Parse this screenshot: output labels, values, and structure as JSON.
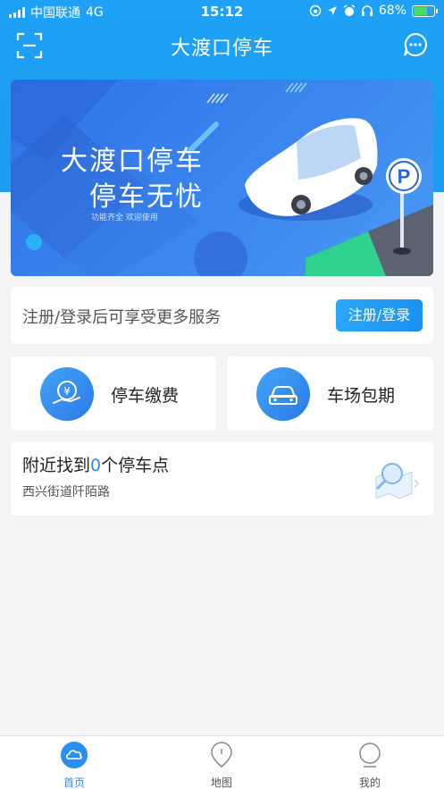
{
  "status_bar": {
    "carrier": "中国联通",
    "network": "4G",
    "time": "15:12",
    "battery": "68%",
    "battery_level": 0.68
  },
  "nav": {
    "title": "大渡口停车"
  },
  "banner": {
    "line1": "大渡口停车",
    "line2": "停车无忧",
    "caption": "功能齐全 欢迎使用"
  },
  "login": {
    "prompt": "注册/登录后可享受更多服务",
    "button_label": "注册/登录"
  },
  "functions": [
    {
      "label": "停车缴费",
      "icon": "yen-hand-icon"
    },
    {
      "label": "车场包期",
      "icon": "car-icon"
    }
  ],
  "nearby": {
    "prefix": "附近找到",
    "count": "0",
    "suffix": "个停车点",
    "address": "西兴街道阡陌路"
  },
  "tabbar": {
    "items": [
      {
        "label": "首页",
        "icon": "home-cloud-icon",
        "active": true
      },
      {
        "label": "地图",
        "icon": "map-pin-icon",
        "active": false
      },
      {
        "label": "我的",
        "icon": "user-icon",
        "active": false
      }
    ]
  },
  "colors": {
    "brand": "#1ea1f6",
    "accent": "#2b8ff0",
    "battery_fill": "#4cd964"
  }
}
